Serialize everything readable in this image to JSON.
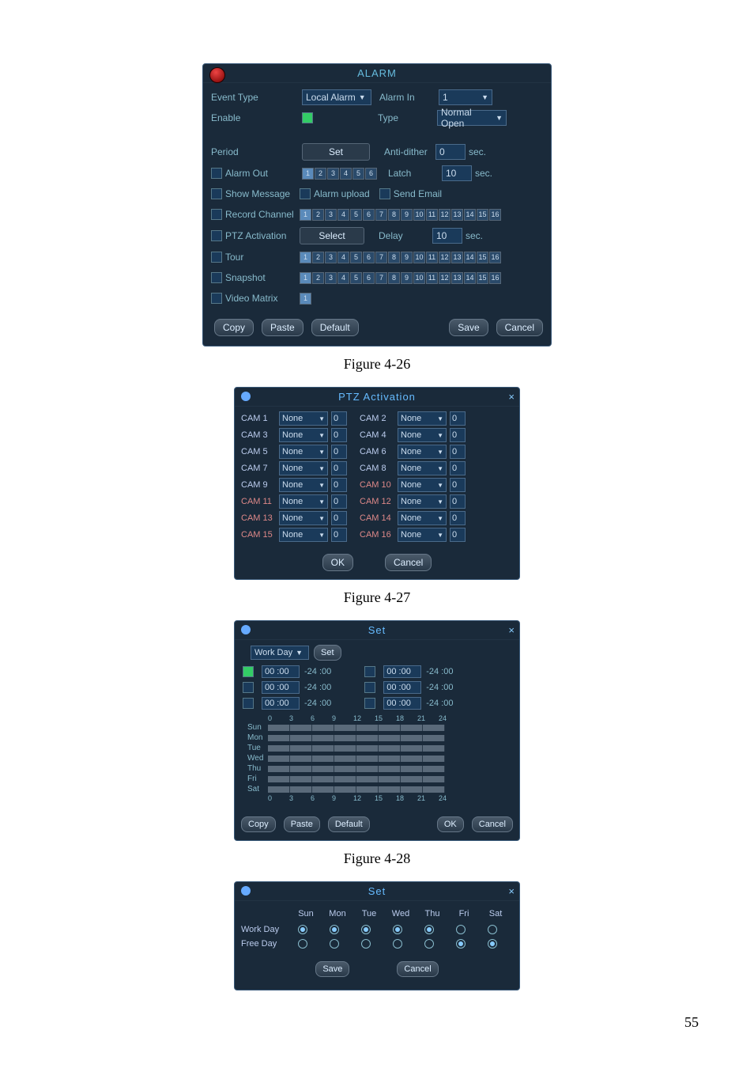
{
  "page_number": "55",
  "figs": {
    "f26": "Figure 4-26",
    "f27": "Figure 4-27",
    "f28": "Figure 4-28"
  },
  "p26": {
    "title": "ALARM",
    "labels": {
      "event_type": "Event Type",
      "alarm_in": "Alarm In",
      "enable": "Enable",
      "type": "Type",
      "period": "Period",
      "anti_dither": "Anti-dither",
      "alarm_out": "Alarm Out",
      "latch": "Latch",
      "show_message": "Show Message",
      "alarm_upload": "Alarm upload",
      "send_email": "Send Email",
      "record_channel": "Record Channel",
      "ptz_activation": "PTZ Activation",
      "delay": "Delay",
      "tour": "Tour",
      "snapshot": "Snapshot",
      "video_matrix": "Video Matrix",
      "sec": "sec."
    },
    "values": {
      "event_type": "Local Alarm",
      "alarm_in": "1",
      "type": "Normal Open",
      "anti_dither": "0",
      "latch": "10",
      "delay": "10"
    },
    "buttons": {
      "set": "Set",
      "select": "Select",
      "copy": "Copy",
      "paste": "Paste",
      "default": "Default",
      "save": "Save",
      "cancel": "Cancel"
    },
    "alarm_out_ch": [
      "1",
      "2",
      "3",
      "4",
      "5",
      "6"
    ],
    "record_ch": [
      "1",
      "2",
      "3",
      "4",
      "5",
      "6",
      "7",
      "8",
      "9",
      "10",
      "11",
      "12",
      "13",
      "14",
      "15",
      "16"
    ],
    "tour_ch": [
      "1",
      "2",
      "3",
      "4",
      "5",
      "6",
      "7",
      "8",
      "9",
      "10",
      "11",
      "12",
      "13",
      "14",
      "15",
      "16"
    ],
    "snapshot_ch": [
      "1",
      "2",
      "3",
      "4",
      "5",
      "6",
      "7",
      "8",
      "9",
      "10",
      "11",
      "12",
      "13",
      "14",
      "15",
      "16"
    ],
    "matrix_ch": [
      "1"
    ]
  },
  "p27": {
    "title": "PTZ Activation",
    "rows": [
      {
        "l": "CAM 1",
        "lv": "None",
        "ln": "0",
        "r": "CAM 2",
        "rv": "None",
        "rn": "0"
      },
      {
        "l": "CAM 3",
        "lv": "None",
        "ln": "0",
        "r": "CAM 4",
        "rv": "None",
        "rn": "0"
      },
      {
        "l": "CAM 5",
        "lv": "None",
        "ln": "0",
        "r": "CAM 6",
        "rv": "None",
        "rn": "0"
      },
      {
        "l": "CAM 7",
        "lv": "None",
        "ln": "0",
        "r": "CAM 8",
        "rv": "None",
        "rn": "0"
      },
      {
        "l": "CAM 9",
        "lv": "None",
        "ln": "0",
        "r": "CAM 10",
        "rv": "None",
        "rn": "0",
        "rd": true
      },
      {
        "l": "CAM 11",
        "lv": "None",
        "ln": "0",
        "r": "CAM 12",
        "rv": "None",
        "rn": "0",
        "ld": true,
        "rd": true
      },
      {
        "l": "CAM 13",
        "lv": "None",
        "ln": "0",
        "r": "CAM 14",
        "rv": "None",
        "rn": "0",
        "ld": true,
        "rd": true
      },
      {
        "l": "CAM 15",
        "lv": "None",
        "ln": "0",
        "r": "CAM 16",
        "rv": "None",
        "rn": "0",
        "ld": true,
        "rd": true
      }
    ],
    "buttons": {
      "ok": "OK",
      "cancel": "Cancel"
    }
  },
  "p28": {
    "title": "Set",
    "workday": "Work Day",
    "set": "Set",
    "periods": [
      {
        "a": "00 :00",
        "b": "-24 :00",
        "c": "00 :00",
        "d": "-24 :00"
      },
      {
        "a": "00 :00",
        "b": "-24 :00",
        "c": "00 :00",
        "d": "-24 :00"
      },
      {
        "a": "00 :00",
        "b": "-24 :00",
        "c": "00 :00",
        "d": "-24 :00"
      }
    ],
    "ticks": [
      "0",
      "3",
      "6",
      "9",
      "12",
      "15",
      "18",
      "21",
      "24"
    ],
    "days": [
      "Sun",
      "Mon",
      "Tue",
      "Wed",
      "Thu",
      "Fri",
      "Sat"
    ],
    "buttons": {
      "copy": "Copy",
      "paste": "Paste",
      "default": "Default",
      "ok": "OK",
      "cancel": "Cancel"
    }
  },
  "p29": {
    "title": "Set",
    "days": [
      "Sun",
      "Mon",
      "Tue",
      "Wed",
      "Thu",
      "Fri",
      "Sat"
    ],
    "rows": [
      {
        "label": "Work Day",
        "sel": [
          true,
          true,
          true,
          true,
          true,
          false,
          false
        ]
      },
      {
        "label": "Free Day",
        "sel": [
          false,
          false,
          false,
          false,
          false,
          true,
          true
        ]
      }
    ],
    "buttons": {
      "save": "Save",
      "cancel": "Cancel"
    }
  }
}
